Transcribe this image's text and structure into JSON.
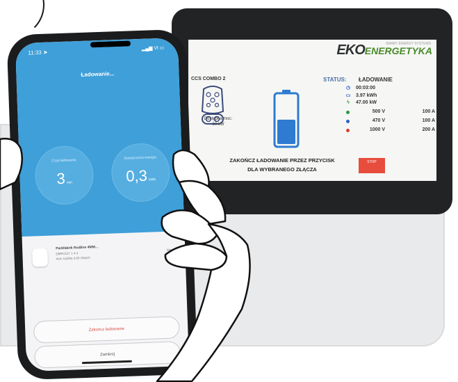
{
  "phone": {
    "status_time": "11:33",
    "status_right": "Vl",
    "title": "Ładowanie...",
    "stats": [
      {
        "label": "Czas ładowania",
        "value": "3",
        "unit": "min"
      },
      {
        "label": "Dostarczona energia",
        "value": "0,3",
        "unit": "kWh"
      }
    ],
    "device": {
      "name": "Parkfabrik Rodline 4MM...",
      "line1": "DMPLE37 1 4 4",
      "line2": "moc szybka 3,00 złotych",
      "right": "Wn"
    },
    "buttons": {
      "finish": "Zakończ ładowanie",
      "cancel": "Zamknij"
    }
  },
  "terminal": {
    "logo_eko": "EKO",
    "logo_energetyka": "ENERGETYKA",
    "logo_tag": "SMART ENERGY SYSTEMS",
    "connector": "CCS COMBO 2",
    "available_power_label": "Dostępna moc:",
    "available_power": "50 kW",
    "status_label": "STATUS:",
    "status_value": "ŁADOWANIE",
    "readings": [
      {
        "icon": "clock-icon",
        "glyph": "◷",
        "value": "00:03:00"
      },
      {
        "icon": "battery-icon",
        "glyph": "▭",
        "value": "3.97 kWh"
      },
      {
        "icon": "bolt-icon",
        "glyph": "ϟ",
        "value": "47.00 kW"
      }
    ],
    "phases": [
      {
        "color": "#2a9a3a",
        "voltage": "500 V",
        "current": "100 A"
      },
      {
        "color": "#2a5fcf",
        "voltage": "470 V",
        "current": "100 A"
      },
      {
        "color": "#d83b2f",
        "voltage": "1000 V",
        "current": "200 A"
      }
    ],
    "finish_line1": "ZAKOŃCZ ŁADOWANIE PRZEZ PRZYCISK",
    "finish_line2": "DLA WYBRANEGO ZŁĄCZA",
    "stop_button": "STOP",
    "battery_level": 0.5
  },
  "colors": {
    "app_blue": "#3f9fd8",
    "terminal_body": "#222325",
    "battery_blue": "#2e7bd1"
  }
}
